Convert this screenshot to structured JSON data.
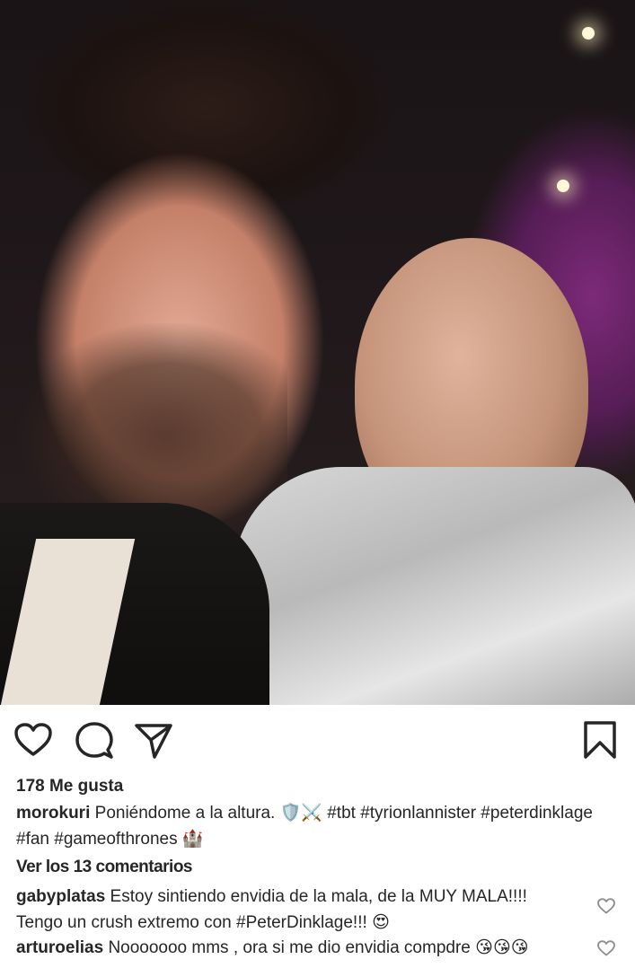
{
  "post": {
    "likes": "178 Me gusta",
    "author": "morokuri",
    "caption_text": "Poniéndome a la altura.",
    "caption_emojis": "🛡️⚔️",
    "caption_tags": "#tbt #tyrionlannister #peterdinklage",
    "caption_tags_line2": "#fan #gameofthrones",
    "caption_end_emoji": "🏰",
    "view_comments": "Ver los 13 comentarios"
  },
  "comments": [
    {
      "username": "gabyplatas",
      "text_line1": "Estoy sintiendo envidia de la mala, de la MUY MALA!!!!",
      "text_line2": "Tengo un crush extremo con #PeterDinklage!!!",
      "emoji": "😍"
    },
    {
      "username": "arturoelias",
      "text_line1": "Nooooooo mms , ora si me dio envidia compdre",
      "emoji": "😘😘😘"
    }
  ],
  "icons": {
    "like": "heart-outline-icon",
    "comment": "comment-bubble-icon",
    "share": "paper-plane-icon",
    "save": "bookmark-icon",
    "comment_like": "small-heart-icon"
  },
  "colors": {
    "text": "#262626",
    "background": "#ffffff"
  }
}
